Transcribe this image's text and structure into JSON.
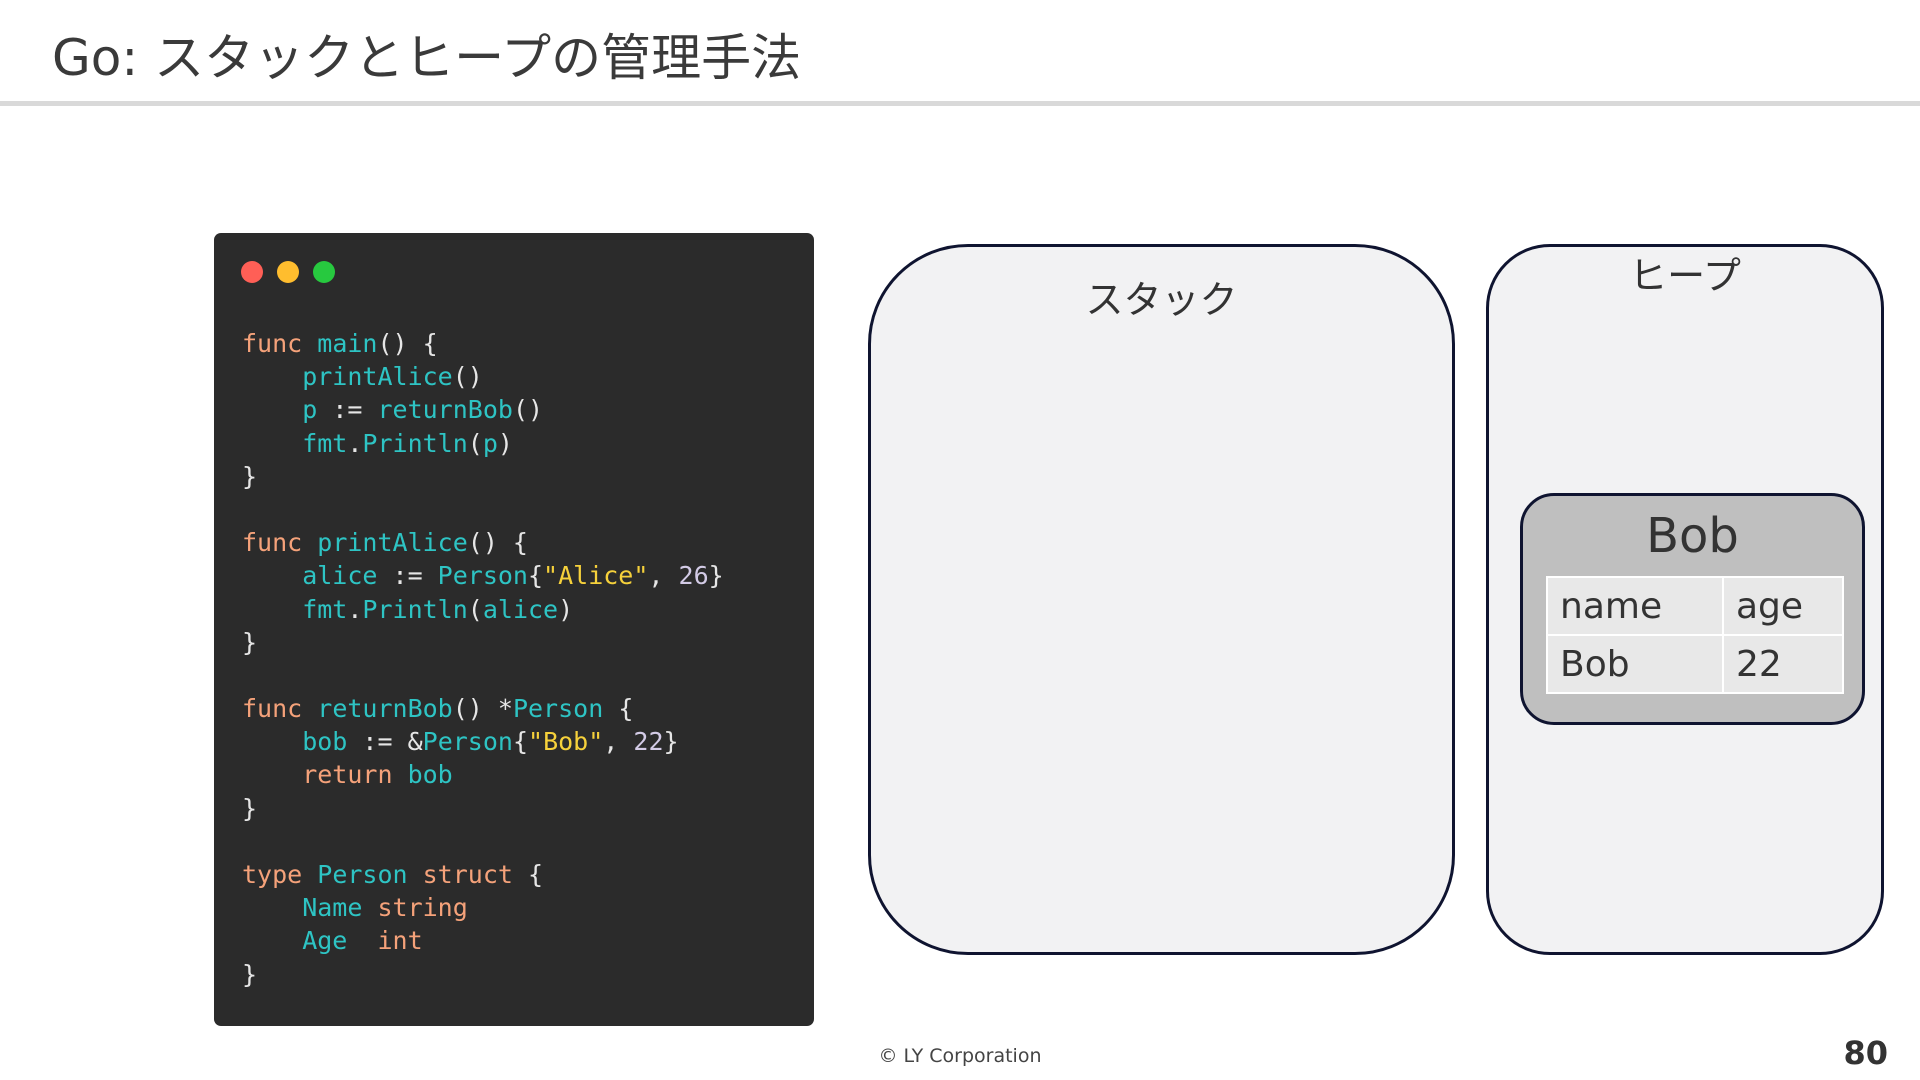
{
  "slide": {
    "title": "Go: スタックとヒープの管理手法",
    "footer": "© LY Corporation",
    "page_number": "80"
  },
  "code_window": {
    "lines": [
      [
        {
          "t": "func ",
          "c": "kw"
        },
        {
          "t": "main",
          "c": "fn"
        },
        {
          "t": "() {",
          "c": "pl"
        }
      ],
      [
        {
          "t": "    printAlice",
          "c": "fn"
        },
        {
          "t": "()",
          "c": "pl"
        }
      ],
      [
        {
          "t": "    p ",
          "c": "fn"
        },
        {
          "t": ":= ",
          "c": "pl"
        },
        {
          "t": "returnBob",
          "c": "fn"
        },
        {
          "t": "()",
          "c": "pl"
        }
      ],
      [
        {
          "t": "    fmt",
          "c": "fn"
        },
        {
          "t": ".",
          "c": "pl"
        },
        {
          "t": "Println",
          "c": "fn"
        },
        {
          "t": "(",
          "c": "pl"
        },
        {
          "t": "p",
          "c": "fn"
        },
        {
          "t": ")",
          "c": "pl"
        }
      ],
      [
        {
          "t": "}",
          "c": "pl"
        }
      ],
      [],
      [
        {
          "t": "func ",
          "c": "kw"
        },
        {
          "t": "printAlice",
          "c": "fn"
        },
        {
          "t": "() {",
          "c": "pl"
        }
      ],
      [
        {
          "t": "    alice ",
          "c": "fn"
        },
        {
          "t": ":= ",
          "c": "pl"
        },
        {
          "t": "Person",
          "c": "fn"
        },
        {
          "t": "{",
          "c": "pl"
        },
        {
          "t": "\"Alice\"",
          "c": "str"
        },
        {
          "t": ", ",
          "c": "pl"
        },
        {
          "t": "26",
          "c": "num"
        },
        {
          "t": "}",
          "c": "pl"
        }
      ],
      [
        {
          "t": "    fmt",
          "c": "fn"
        },
        {
          "t": ".",
          "c": "pl"
        },
        {
          "t": "Println",
          "c": "fn"
        },
        {
          "t": "(",
          "c": "pl"
        },
        {
          "t": "alice",
          "c": "fn"
        },
        {
          "t": ")",
          "c": "pl"
        }
      ],
      [
        {
          "t": "}",
          "c": "pl"
        }
      ],
      [],
      [
        {
          "t": "func ",
          "c": "kw"
        },
        {
          "t": "returnBob",
          "c": "fn"
        },
        {
          "t": "() *",
          "c": "pl"
        },
        {
          "t": "Person",
          "c": "fn"
        },
        {
          "t": " {",
          "c": "pl"
        }
      ],
      [
        {
          "t": "    bob ",
          "c": "fn"
        },
        {
          "t": ":= &",
          "c": "pl"
        },
        {
          "t": "Person",
          "c": "fn"
        },
        {
          "t": "{",
          "c": "pl"
        },
        {
          "t": "\"Bob\"",
          "c": "str"
        },
        {
          "t": ", ",
          "c": "pl"
        },
        {
          "t": "22",
          "c": "num"
        },
        {
          "t": "}",
          "c": "pl"
        }
      ],
      [
        {
          "t": "    return ",
          "c": "kw"
        },
        {
          "t": "bob",
          "c": "fn"
        }
      ],
      [
        {
          "t": "}",
          "c": "pl"
        }
      ],
      [],
      [
        {
          "t": "type ",
          "c": "kw"
        },
        {
          "t": "Person ",
          "c": "fn"
        },
        {
          "t": "struct",
          "c": "kw"
        },
        {
          "t": " {",
          "c": "pl"
        }
      ],
      [
        {
          "t": "    Name ",
          "c": "fn"
        },
        {
          "t": "string",
          "c": "kw"
        }
      ],
      [
        {
          "t": "    Age  ",
          "c": "fn"
        },
        {
          "t": "int",
          "c": "kw"
        }
      ],
      [
        {
          "t": "}",
          "c": "pl"
        }
      ]
    ]
  },
  "stack_panel": {
    "label": "スタック"
  },
  "heap_panel": {
    "label": "ヒープ",
    "object": {
      "name": "Bob",
      "table": {
        "headers": [
          "name",
          "age"
        ],
        "row": [
          "Bob",
          "22"
        ]
      }
    }
  },
  "colors": {
    "code_background": "#2b2b2b",
    "keyword": "#f5a27a",
    "identifier": "#2ec4c4",
    "string": "#f6d13b",
    "number": "#d3cbe6",
    "panel_border": "#0f1430",
    "panel_fill": "#f2f2f3",
    "object_fill": "#bfbfbf"
  }
}
